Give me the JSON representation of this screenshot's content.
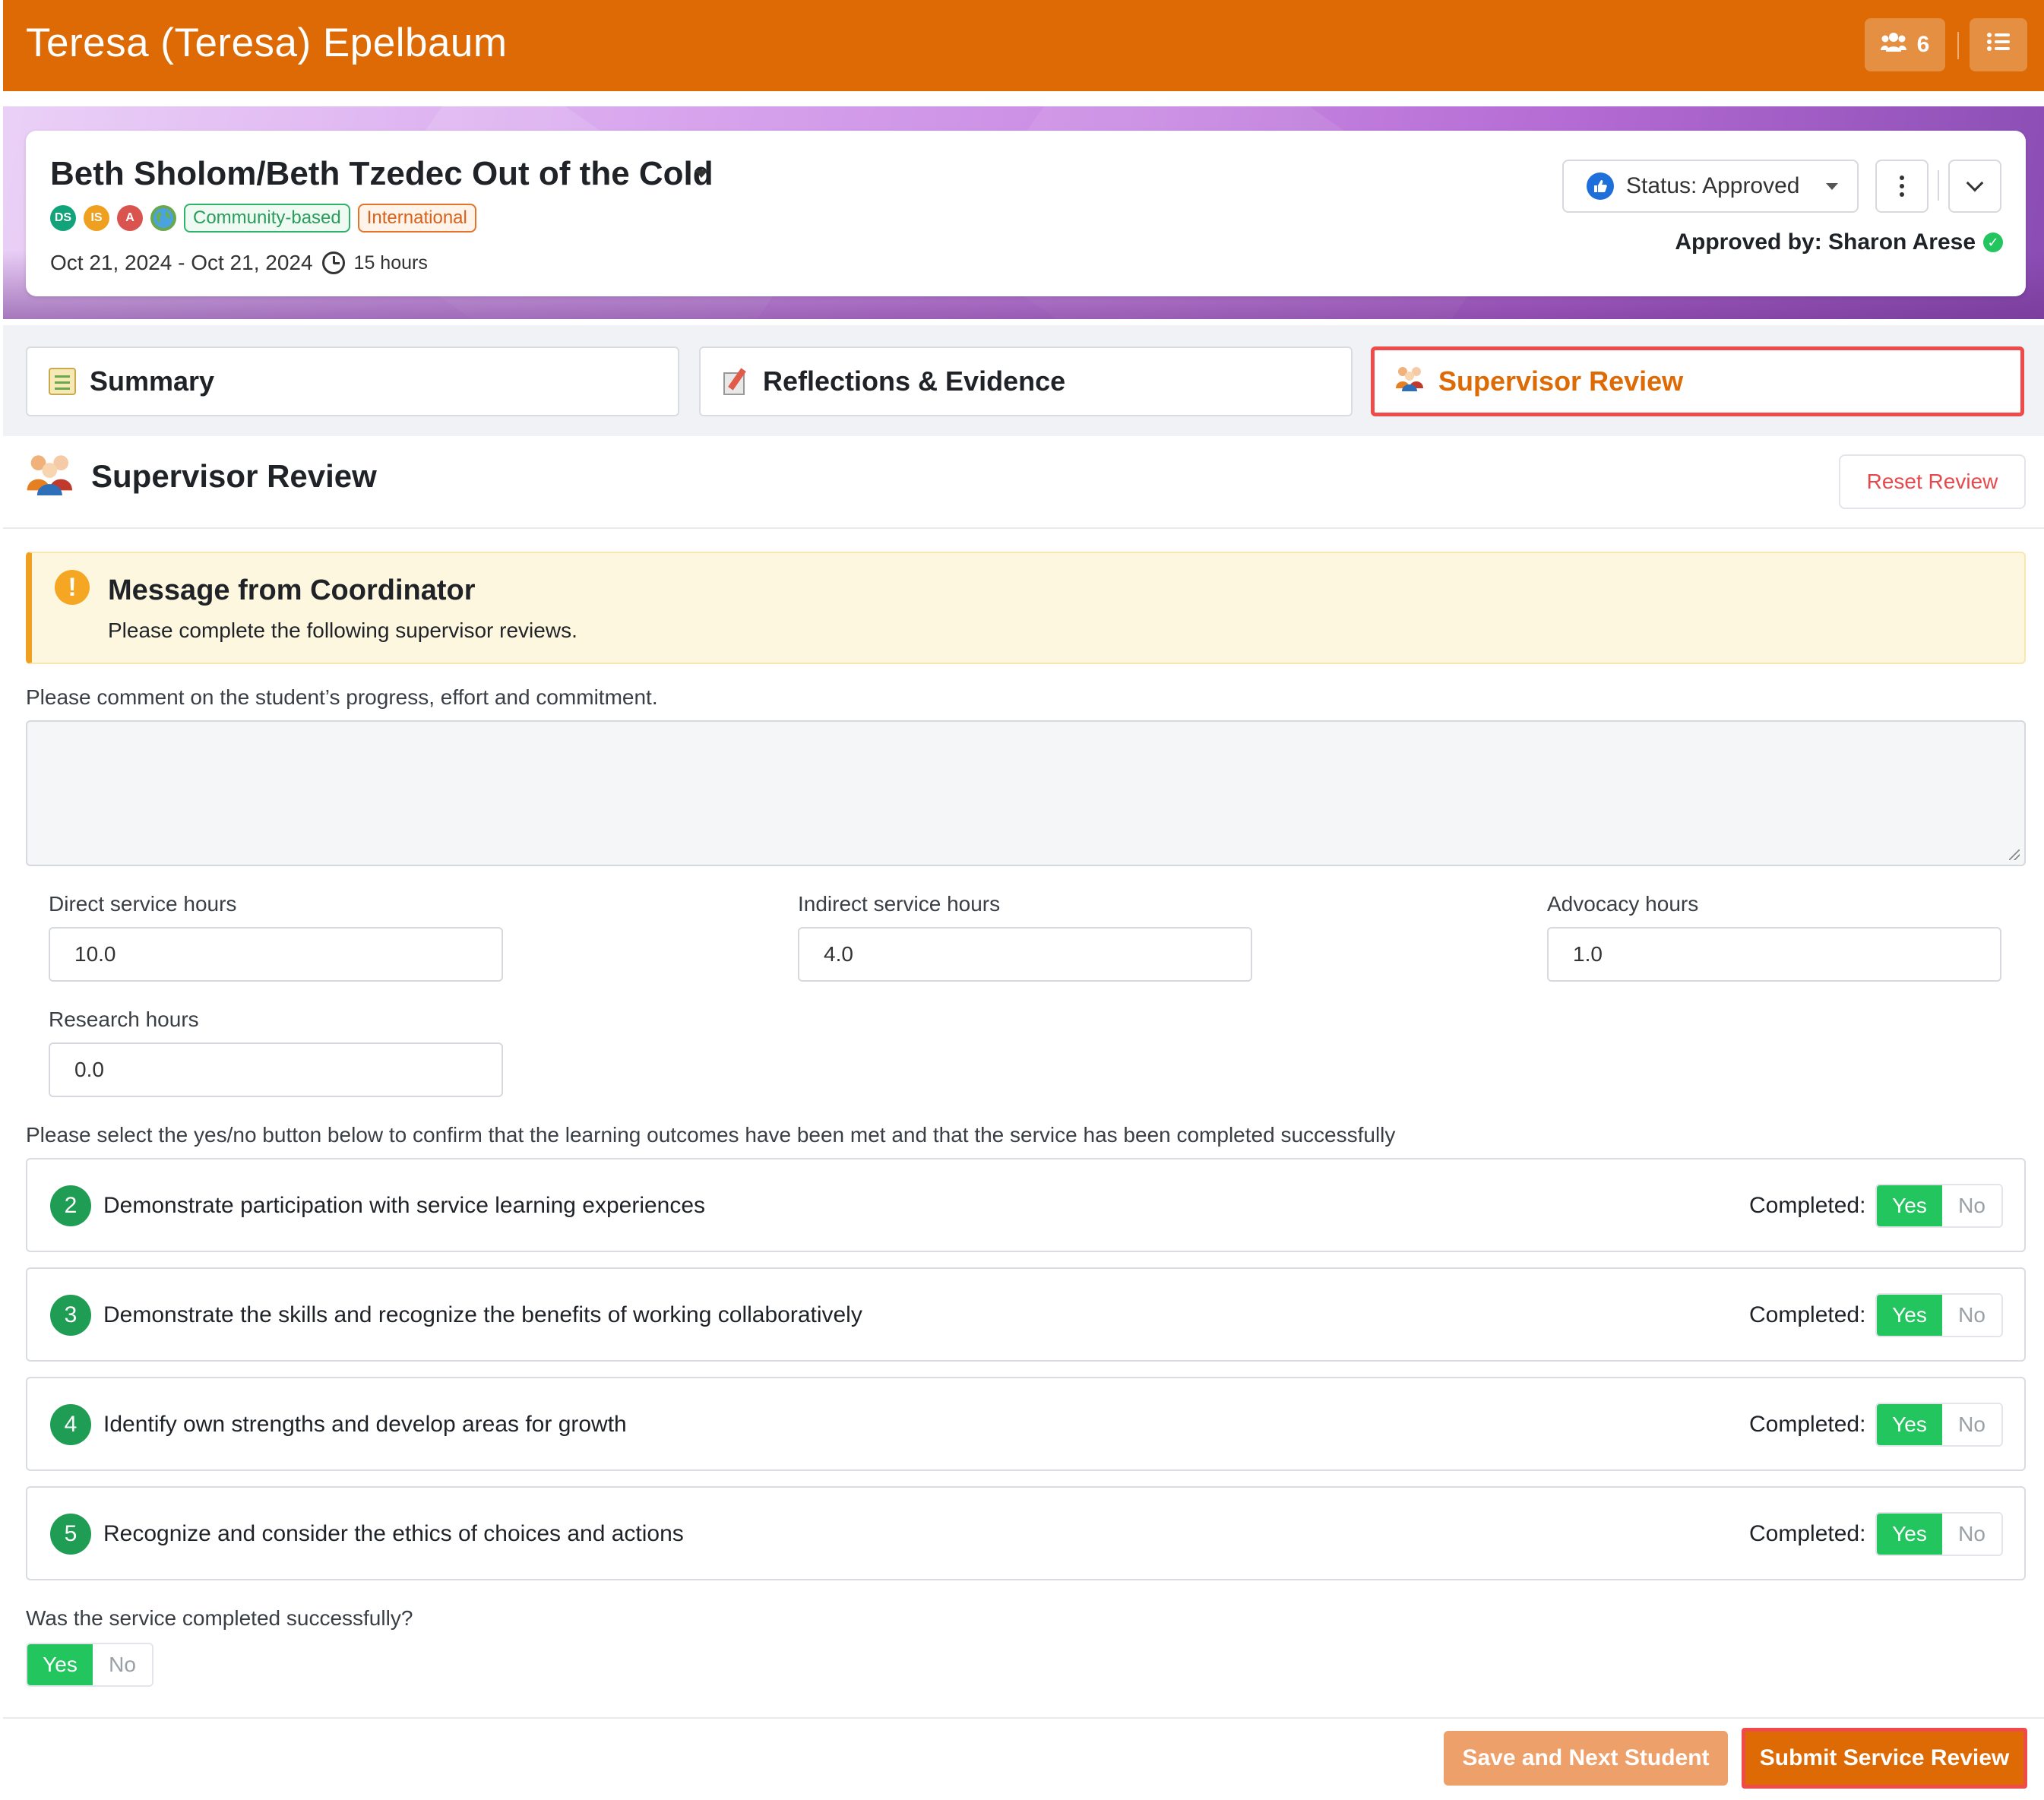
{
  "header": {
    "title": "Teresa (Teresa) Epelbaum",
    "members_count": "6",
    "members_icon": "users-icon",
    "menu_icon": "list-icon"
  },
  "project": {
    "title": "Beth Sholom/Beth Tzedec Out of the Cold",
    "avatars": [
      "DS",
      "IS",
      "A"
    ],
    "globe_icon": "globe-icon",
    "tags": [
      "Community-based",
      "International"
    ],
    "dates": "Oct 21, 2024 - Oct 21, 2024",
    "hours": "15 hours",
    "status_label": "Status: Approved",
    "approved_by": "Approved by: Sharon Arese"
  },
  "tabs": [
    {
      "label": "Summary",
      "icon": "summary-icon",
      "active": false
    },
    {
      "label": "Reflections & Evidence",
      "icon": "reflections-icon",
      "active": false
    },
    {
      "label": "Supervisor Review",
      "icon": "supervisor-icon",
      "active": true
    }
  ],
  "review": {
    "title": "Supervisor Review",
    "reset_label": "Reset Review",
    "message": {
      "title": "Message from Coordinator",
      "body": "Please complete the following supervisor reviews."
    },
    "comment_prompt": "Please comment on the student’s progress, effort and commitment.",
    "comment_value": "",
    "fields": [
      {
        "label": "Direct service hours",
        "value": "10.0"
      },
      {
        "label": "Indirect service hours",
        "value": "4.0"
      },
      {
        "label": "Advocacy hours",
        "value": "1.0"
      },
      {
        "label": "Research hours",
        "value": "0.0"
      }
    ],
    "outcomes_prompt": "Please select the yes/no button below to confirm that the learning outcomes have been met and that the service has been completed successfully",
    "completed_label": "Completed:",
    "yes_label": "Yes",
    "no_label": "No",
    "outcomes": [
      {
        "number": "2",
        "text": "Demonstrate participation with service learning experiences",
        "selected": "Yes"
      },
      {
        "number": "3",
        "text": "Demonstrate the skills and recognize the benefits of working collaboratively",
        "selected": "Yes"
      },
      {
        "number": "4",
        "text": "Identify own strengths and develop areas for growth",
        "selected": "Yes"
      },
      {
        "number": "5",
        "text": "Recognize and consider the ethics of choices and actions",
        "selected": "Yes"
      }
    ],
    "success_prompt": "Was the service completed successfully?",
    "success_selected": "Yes"
  },
  "footer": {
    "save_label": "Save and Next Student",
    "submit_label": "Submit Service Review"
  },
  "colors": {
    "brand_orange": "#dd6a05",
    "yes_green": "#22c55e",
    "highlight_red": "#ef4b4b"
  }
}
